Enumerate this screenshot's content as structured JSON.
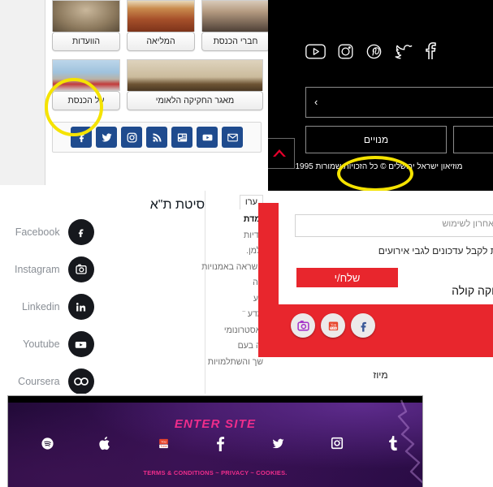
{
  "knesset": {
    "tiles": [
      {
        "label": "הוועדות",
        "icon": "committee-room-photo"
      },
      {
        "label": "המליאה",
        "icon": "plenum-hall-photo"
      },
      {
        "label": "חברי הכנסת",
        "icon": "knesset-members-photo"
      },
      {
        "label": "על הכנסת",
        "icon": "knesset-building-photo"
      },
      {
        "label": "מאגר החקיקה הלאומי",
        "icon": "knesset-podium-photo"
      }
    ],
    "social": [
      {
        "name": "facebook-icon"
      },
      {
        "name": "twitter-icon"
      },
      {
        "name": "instagram-icon"
      },
      {
        "name": "rss-icon"
      },
      {
        "name": "newsletter-icon"
      },
      {
        "name": "youtube-icon"
      },
      {
        "name": "email-icon"
      }
    ],
    "highlight_color": "#f5e300"
  },
  "museum": {
    "social": [
      {
        "name": "youtube-icon"
      },
      {
        "name": "instagram-icon"
      },
      {
        "name": "pinterest-icon"
      },
      {
        "name": "twitter-icon"
      },
      {
        "name": "facebook-icon"
      }
    ],
    "search_value": "",
    "chevron": "‹",
    "buttons": [
      {
        "label": "מנויים"
      },
      {
        "label": ""
      }
    ],
    "copyright": "מוזיאון ישראל ירושלים © כל הזכויות שמורות 1995",
    "scroll_top_icon": "chevron-up-icon",
    "accent_color": "#e4002b",
    "background_color": "#000000"
  },
  "tau": {
    "title": "אוניברסיטת ת\"א",
    "social": [
      {
        "label": "Facebook",
        "icon": "facebook-icon"
      },
      {
        "label": "Instagram",
        "icon": "instagram-icon"
      },
      {
        "label": "Linkedin",
        "icon": "linkedin-icon"
      },
      {
        "label": "Youtube",
        "icon": "youtube-icon"
      },
      {
        "label": "Coursera",
        "icon": "coursera-icon"
      }
    ],
    "menu_header": "ערו",
    "menu_items": [
      {
        "label": "ומדת",
        "bold": true
      },
      {
        "label": "וודיות",
        "bold": false
      },
      {
        "label": "ילמן.",
        "bold": false
      },
      {
        "label": "השראה באמנויות",
        "bold": false
      },
      {
        "label": "קה",
        "bold": false
      },
      {
        "label": "בע",
        "bold": false
      },
      {
        "label": "מדע ¨",
        "bold": false
      },
      {
        "label": "ואסטרונומי",
        "bold": false
      },
      {
        "label": "יה בעם",
        "bold": false
      },
      {
        "label": "שך והשתלמויות",
        "bold": false
      }
    ]
  },
  "newsletter": {
    "input_placeholder": "אחרון לשימוש",
    "input_value": "",
    "note": "יינת לקבל עדכונים לגבי אירועים",
    "send_label": "שלח/י",
    "brand": "קוקה קולה",
    "social": [
      {
        "name": "instagram-icon"
      },
      {
        "name": "youtube-icon"
      },
      {
        "name": "facebook-icon"
      }
    ],
    "background_color": "#e8262d",
    "caption_below": "מיוז"
  },
  "enter_site": {
    "heading": "ENTER SITE",
    "social": [
      {
        "name": "spotify-icon"
      },
      {
        "name": "apple-icon"
      },
      {
        "name": "youtube-icon"
      },
      {
        "name": "facebook-icon"
      },
      {
        "name": "twitter-icon"
      },
      {
        "name": "instagram-icon"
      },
      {
        "name": "tumblr-icon"
      }
    ],
    "terms": "TERMS & CONDITIONS ~ PRIVACY ~ COOKIES.",
    "accent_color": "#ef2d8b"
  }
}
